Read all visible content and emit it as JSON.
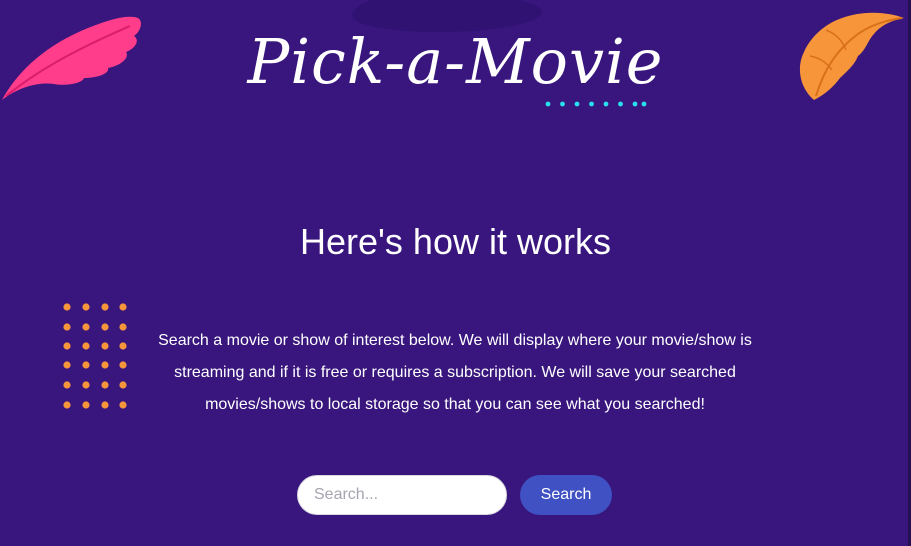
{
  "header": {
    "title": "Pick-a-Movie"
  },
  "main": {
    "heading": "Here's how it works",
    "description_lines": [
      "Search a movie or show of interest below. We will display where your movie/show is",
      "streaming and if it is free or requires a subscription. We will save your searched",
      "movies/shows to local storage so that you can see what you searched!"
    ]
  },
  "search": {
    "placeholder": "Search...",
    "value": "",
    "button_label": "Search"
  },
  "decorations": {
    "left_leaf_icon": "pink-leaf-icon",
    "right_leaf_icon": "orange-leaf-icon",
    "dot_grid_icon": "orange-dot-grid-icon",
    "title_underline_icon": "cyan-dotted-underline-icon"
  },
  "colors": {
    "background": "#38167d",
    "accent_button": "#3f51c3",
    "pink_leaf": "#ff3d8b",
    "orange_leaf": "#f7953a",
    "dot_orange": "#f7953a",
    "dot_cyan": "#29e0f0",
    "text": "#ffffff"
  }
}
